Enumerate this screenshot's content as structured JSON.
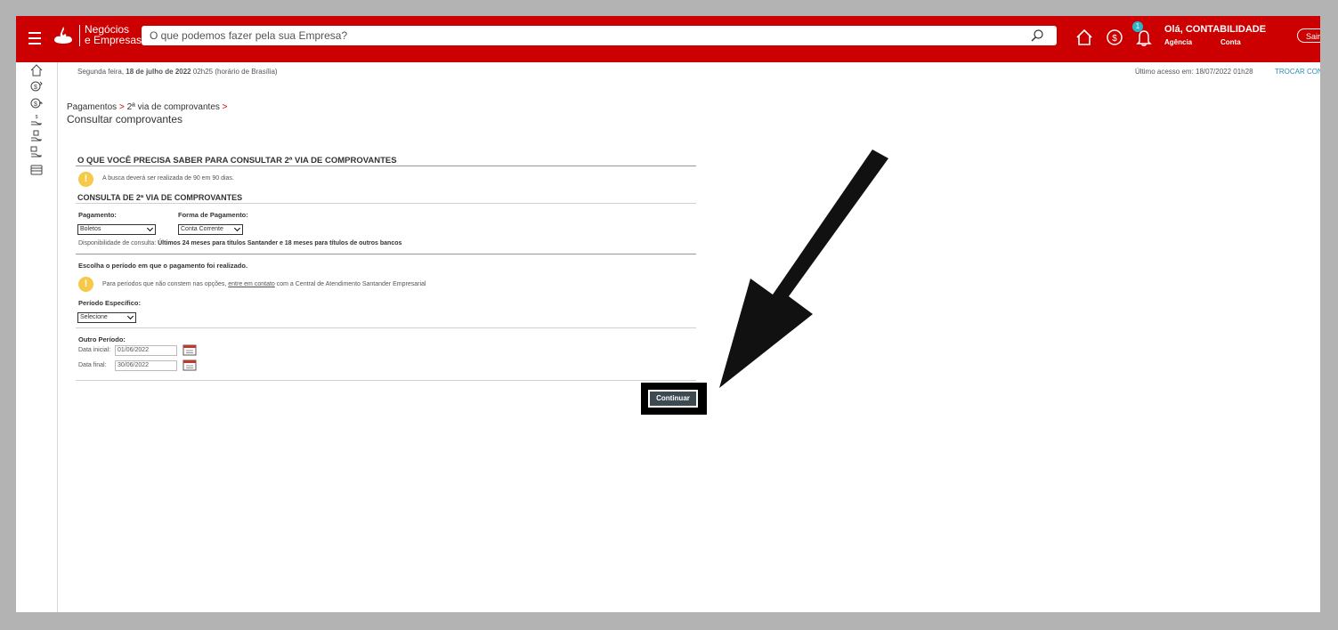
{
  "header": {
    "brand_line1": "Negócios",
    "brand_line2": "e Empresas",
    "search_placeholder": "O que podemos fazer pela sua Empresa?",
    "notification_count": "1",
    "greeting": "Olá, CONTABILIDADE",
    "agencia_label": "Agência",
    "conta_label": "Conta",
    "logout_label": "Sair"
  },
  "topbar": {
    "date_prefix": "Segunda feira, ",
    "date_bold": "18 de julho de 2022",
    "time": " 02h25 (horário de Brasília)",
    "last_access": "Último acesso em: 18/07/2022  01h28",
    "switch_link": "TROCAR CONT"
  },
  "breadcrumb": {
    "item1": "Pagamentos",
    "sep": ">",
    "item2": "2ª via de comprovantes"
  },
  "page_title": "Consultar comprovantes",
  "info_section": {
    "title": "O QUE VOCÊ PRECISA SABER PARA CONSULTAR 2ª VIA DE COMPROVANTES",
    "notice": "A busca deverá ser realizada de 90 em 90 dias."
  },
  "query_section": {
    "title": "CONSULTA DE 2ª VIA DE COMPROVANTES",
    "payment_label": "Pagamento:",
    "payment_value": "Boletos",
    "method_label": "Forma de Pagamento:",
    "method_value": "Conta Corrente",
    "availability_prefix": "Disponibilidade de consulta: ",
    "availability_bold": "Últimos 24 meses para títulos Santander e 18 meses para títulos de outros bancos"
  },
  "period_section": {
    "title": "Escolha o período em que o pagamento foi realizado.",
    "notice_prefix": "Para períodos que não constem nas opções, ",
    "notice_link": "entre em contato",
    "notice_suffix": " com a Central de Atendimento Santander Empresarial",
    "specific_label": "Período Específico:",
    "specific_value": "Selecione",
    "other_label": "Outro Período:",
    "start_label": "Data inicial:",
    "start_value": "01/06/2022",
    "end_label": "Data final:",
    "end_value": "30/06/2022"
  },
  "continue_label": "Continuar",
  "colors": {
    "brand_red": "#cc0000",
    "button": "#3d4a52",
    "warning": "#f7c948",
    "badge": "#2bb5c8"
  }
}
